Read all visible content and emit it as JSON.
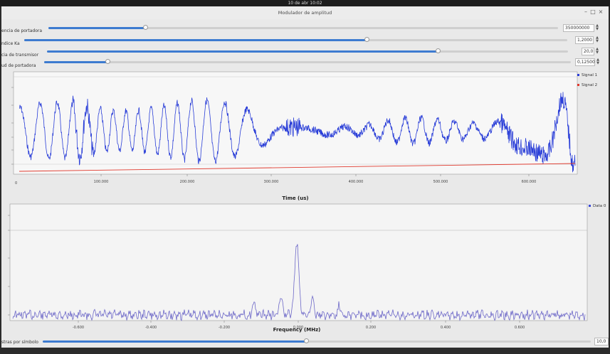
{
  "os": {
    "clock": "10 de abr  10:02"
  },
  "window": {
    "title": "Modulador de amplitud"
  },
  "controls": [
    {
      "label": "encia de portadora",
      "value": "350000000",
      "level": 0.19
    },
    {
      "label": "ndice Ka",
      "value": "1,2000",
      "level": 0.63
    },
    {
      "label": "cia de transmisor",
      "value": "20,0",
      "level": 0.75
    },
    {
      "label": "ud de portadora",
      "value": "0,12500",
      "level": 0.12
    }
  ],
  "time_plot": {
    "xlabel": "Time (us)",
    "xticks": [
      "100.000",
      "200.000",
      "300.000",
      "400.000",
      "500.000",
      "600.000"
    ],
    "legend": [
      {
        "name": "Signal 1",
        "color": "#2b3fd8"
      },
      {
        "name": "Signal 2",
        "color": "#e03a2e"
      }
    ]
  },
  "freq_plot": {
    "xlabel": "Frequency (MHz)",
    "xticks": [
      "-0.600",
      "-0.400",
      "-0.200",
      "0.000",
      "0.200",
      "0.400",
      "0.600"
    ],
    "legend": [
      {
        "name": "Data 0",
        "color": "#3b4bd8"
      }
    ]
  },
  "bottom": {
    "label": "stras por símbolo",
    "value": "10,0",
    "level": 0.48
  },
  "colors": {
    "slider_fill": "#3d7bd0",
    "signal1": "#2b3fd8",
    "signal2": "#e03a2e",
    "spectrum": "#6d68c8"
  }
}
